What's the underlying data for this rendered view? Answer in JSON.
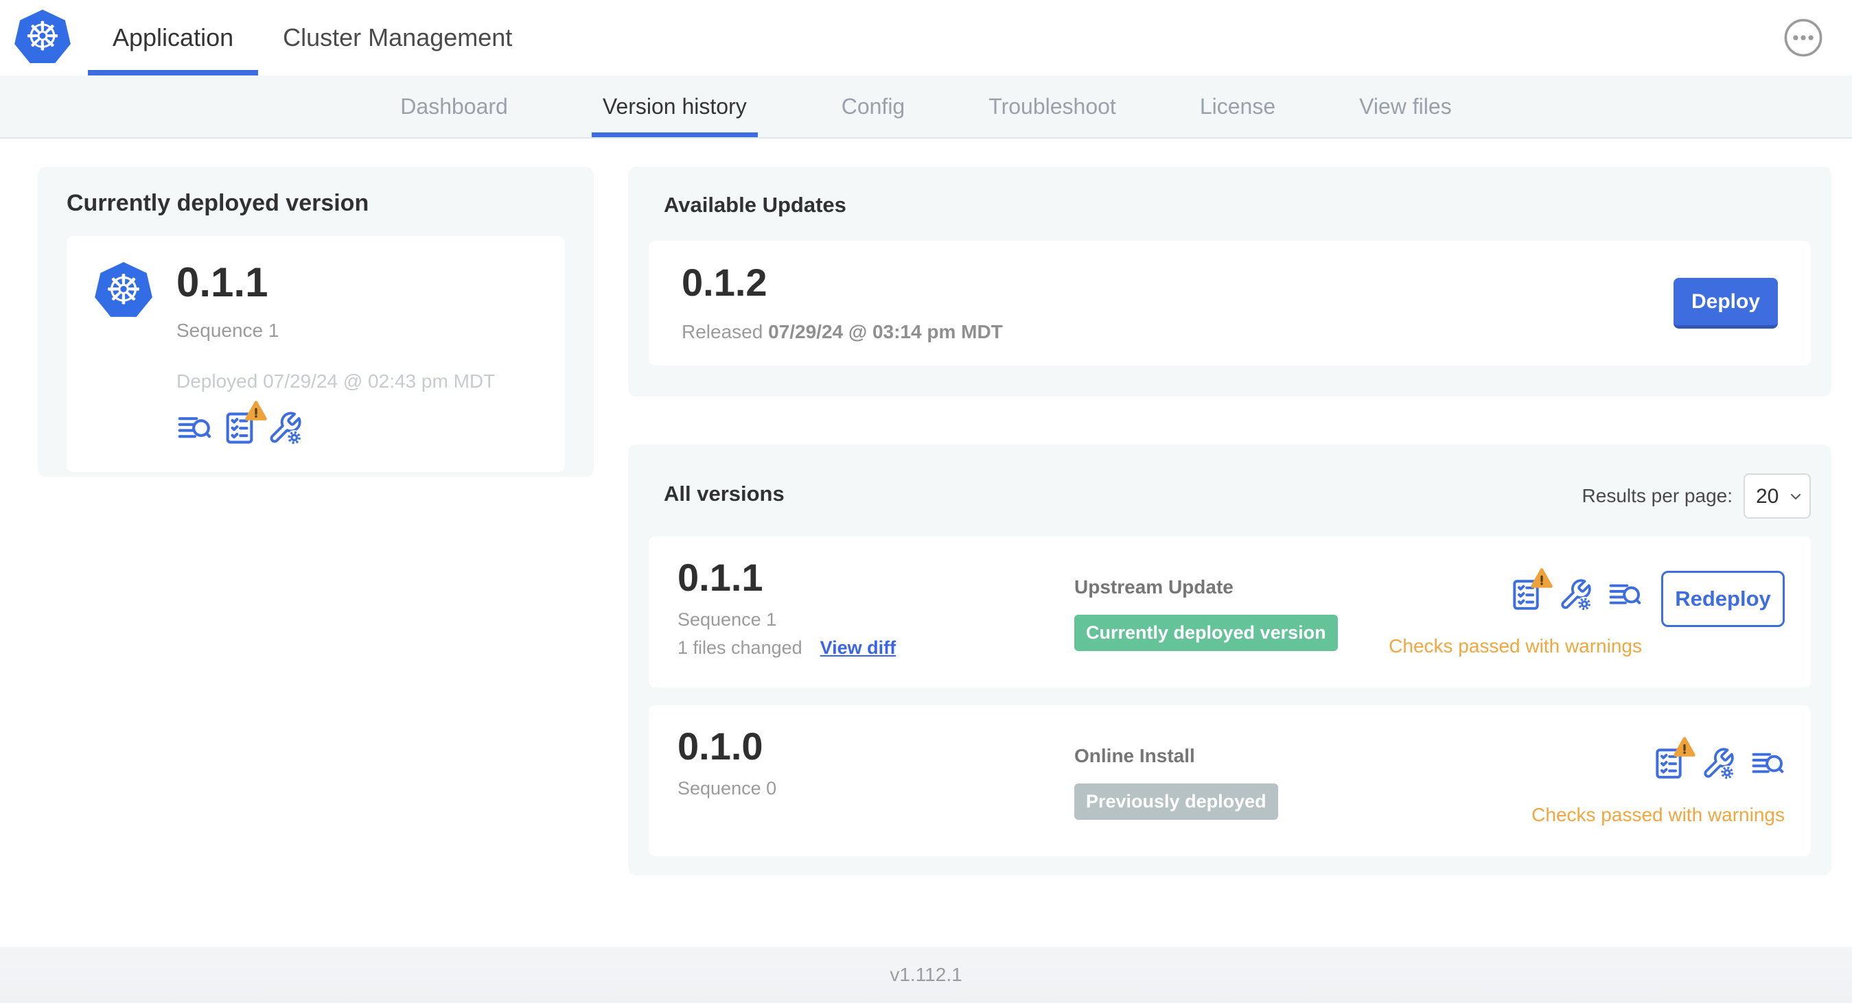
{
  "colors": {
    "accent-blue": "#3d6ddf",
    "k8s-blue": "#326de6",
    "badge-green": "#64c398",
    "badge-gray": "#b7c2c5",
    "warning-orange": "#eda23b",
    "warning-text": "#f0a73f"
  },
  "icons": {
    "kubernetes_logo_glyph": "☸"
  },
  "header": {
    "tabs": [
      {
        "label": "Application",
        "active": true
      },
      {
        "label": "Cluster Management",
        "active": false
      }
    ],
    "menu_icon": "ellipsis-menu-icon"
  },
  "subnav": {
    "tabs": [
      "Dashboard",
      "Version history",
      "Config",
      "Troubleshoot",
      "License",
      "View files"
    ],
    "active_tab": "Version history"
  },
  "deployed_card": {
    "title": "Currently deployed version",
    "version": "0.1.1",
    "sequence": "Sequence 1",
    "deployed_at": "Deployed 07/29/24 @ 02:43 pm MDT",
    "icons": [
      "logs-icon",
      "preflight-checks-warning-icon",
      "config-icon"
    ]
  },
  "available_updates": {
    "title": "Available Updates",
    "version": "0.1.2",
    "released_label": "Released",
    "released_at": "07/29/24 @ 03:14 pm MDT",
    "deploy_label": "Deploy"
  },
  "all_versions": {
    "title": "All versions",
    "results_per_page_label": "Results per page:",
    "results_per_page_value": "20",
    "rows": [
      {
        "version": "0.1.1",
        "sequence": "Sequence 1",
        "files_changed": "1 files changed",
        "view_diff_label": "View diff",
        "source": "Upstream Update",
        "badge": {
          "label": "Currently deployed version",
          "color": "green"
        },
        "status": "Checks passed with warnings",
        "action_label": "Redeploy",
        "icons": [
          "preflight-checks-warning-icon",
          "config-icon",
          "logs-icon"
        ]
      },
      {
        "version": "0.1.0",
        "sequence": "Sequence 0",
        "source": "Online Install",
        "badge": {
          "label": "Previously deployed",
          "color": "gray"
        },
        "status": "Checks passed with warnings",
        "icons": [
          "preflight-checks-warning-icon",
          "config-icon",
          "logs-icon"
        ]
      }
    ]
  },
  "footer": {
    "app_version": "v1.112.1"
  }
}
